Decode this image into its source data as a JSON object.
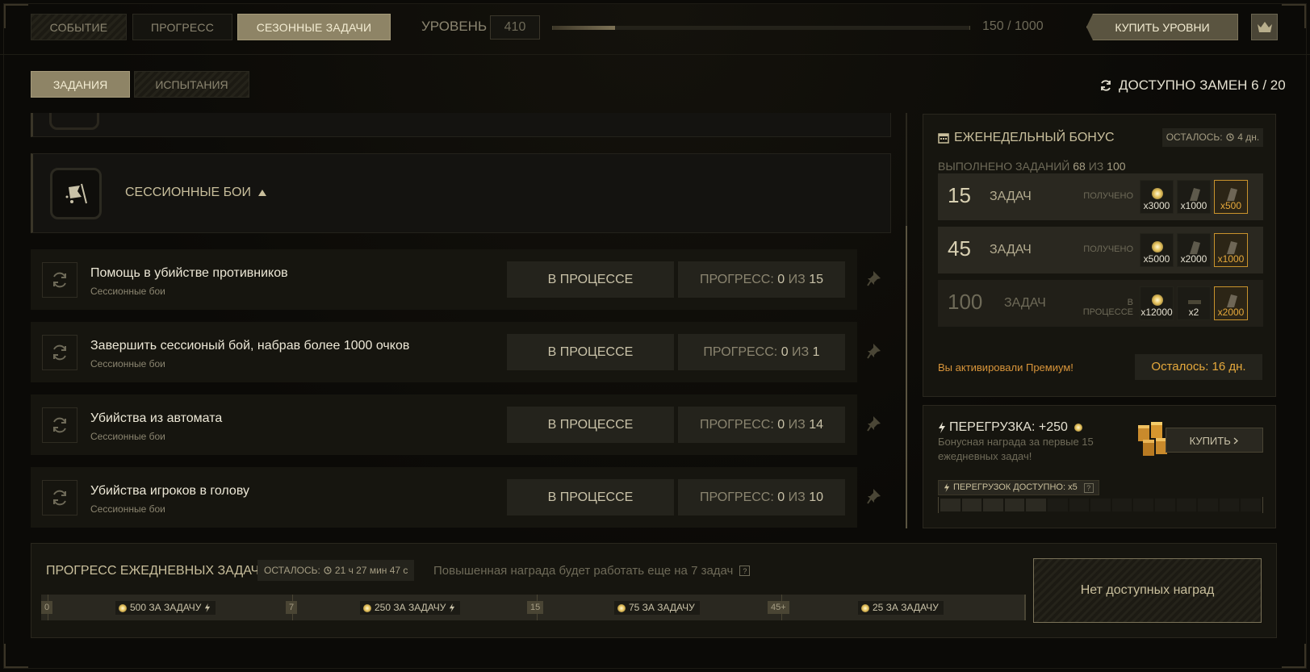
{
  "topbar": {
    "tabs": [
      {
        "label": "СОБЫТИЕ",
        "active": false
      },
      {
        "label": "ПРОГРЕСС",
        "active": false
      },
      {
        "label": "СЕЗОННЫЕ ЗАДАЧИ",
        "active": true
      }
    ],
    "level_label": "УРОВЕНЬ",
    "level_value": "410",
    "level_progress_text": "150 / 1000",
    "level_progress_fraction": 0.15,
    "buy_levels_label": "КУПИТЬ УРОВНИ",
    "crown_icon": "crown-icon"
  },
  "subtabs": [
    {
      "label": "ЗАДАНИЯ",
      "active": true
    },
    {
      "label": "ИСПЫТАНИЯ",
      "active": false
    }
  ],
  "replacements": {
    "label": "ДОСТУПНО ЗАМЕН 6 / 20",
    "icon": "refresh-icon"
  },
  "category": {
    "title": "СЕССИОННЫЕ БОИ",
    "icon": "flag-icon"
  },
  "tasks": [
    {
      "title": "Помощь в убийстве противников",
      "category": "Сессионные бои",
      "status": "В ПРОЦЕССЕ",
      "progress_label": "ПРОГРЕСС:",
      "progress_current": "0",
      "progress_of": "ИЗ",
      "progress_total": "15"
    },
    {
      "title": "Завершить сессионый бой, набрав более 1000 очков",
      "category": "Сессионные бои",
      "status": "В ПРОЦЕССЕ",
      "progress_label": "ПРОГРЕСС:",
      "progress_current": "0",
      "progress_of": "ИЗ",
      "progress_total": "1"
    },
    {
      "title": "Убийства из автомата",
      "category": "Сессионные бои",
      "status": "В ПРОЦЕССЕ",
      "progress_label": "ПРОГРЕСС:",
      "progress_current": "0",
      "progress_of": "ИЗ",
      "progress_total": "14"
    },
    {
      "title": "Убийства игроков в голову",
      "category": "Сессионные бои",
      "status": "В ПРОЦЕССЕ",
      "progress_label": "ПРОГРЕСС:",
      "progress_current": "0",
      "progress_of": "ИЗ",
      "progress_total": "10"
    }
  ],
  "weekly": {
    "title": "ЕЖЕНЕДЕЛЬНЫЙ БОНУС",
    "time_left": "ОСТАЛОСЬ:",
    "time_left_value": "4 дн.",
    "done_label": "ВЫПОЛНЕНО ЗАДАНИЙ",
    "done_count": "68",
    "done_of": "ИЗ",
    "done_total": "100",
    "tiers": [
      {
        "num": "15",
        "label": "ЗАДАЧ",
        "state": "ПОЛУЧЕНО",
        "rewards": [
          "x3000",
          "x1000",
          "x500"
        ]
      },
      {
        "num": "45",
        "label": "ЗАДАЧ",
        "state": "ПОЛУЧЕНО",
        "rewards": [
          "x5000",
          "x2000",
          "x1000"
        ]
      },
      {
        "num": "100",
        "label": "ЗАДАЧ",
        "state": "В ПРОЦЕССЕ",
        "rewards": [
          "x12000",
          "x2",
          "x2000"
        ]
      }
    ],
    "premium_message": "Вы активировали Премиум!",
    "premium_left": "Осталось: 16 дн."
  },
  "overload": {
    "title": "ПЕРЕГРУЗКА: +250",
    "description": "Бонусная награда за первые 15 ежедневных задач!",
    "buy_label": "КУПИТЬ",
    "available_label": "ПЕРЕГРУЗОК ДОСТУПНО: x5",
    "help": "?",
    "segments_total": 15,
    "segments_filled": 5
  },
  "daily": {
    "title": "ПРОГРЕСС ЕЖЕДНЕВНЫХ ЗАДАЧ",
    "time_left": "ОСТАЛОСЬ:",
    "time_left_value": "21 ч 27 мин 47 с",
    "note": "Повышенная награда будет работать еще на 7 задач",
    "help": "?",
    "markers": [
      "0",
      "7",
      "15",
      "45+"
    ],
    "chips": [
      "500 ЗА ЗАДАЧУ",
      "250 ЗА ЗАДАЧУ",
      "75 ЗА ЗАДАЧУ",
      "25 ЗА ЗАДАЧУ"
    ],
    "no_rewards": "Нет доступных наград"
  },
  "colors": {
    "accent": "#8e8466",
    "premium": "#e6a93c",
    "background": "#0b0a07"
  }
}
